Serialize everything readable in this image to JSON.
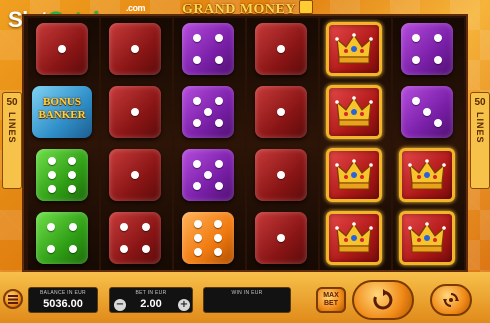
{
  "watermark": {
    "slot": "Slot",
    "catalog": "Catalog",
    "dotcom": ".com"
  },
  "game_title": "GRAND MONEY",
  "lines_indicator": {
    "count": "50",
    "word": "LINES"
  },
  "reels": [
    {
      "symbols": [
        "die-red-1",
        "bonus-banker",
        "die-green-6",
        "die-green-4"
      ]
    },
    {
      "symbols": [
        "die-red-1",
        "die-red-1",
        "die-red-1",
        "die-red-4"
      ]
    },
    {
      "symbols": [
        "die-purple-4",
        "die-purple-5",
        "die-purple-5",
        "die-orange-6"
      ]
    },
    {
      "symbols": [
        "die-red-1",
        "die-red-1",
        "die-red-1",
        "die-red-1"
      ]
    },
    {
      "symbols": [
        "crown",
        "crown",
        "crown",
        "crown"
      ]
    },
    {
      "symbols": [
        "die-purple-4",
        "die-purple-3",
        "crown",
        "crown"
      ]
    }
  ],
  "bonus_symbol_label": "BONUS BANKER",
  "balance": {
    "label": "BALANCE IN EUR",
    "value": "5036.00"
  },
  "bet": {
    "label": "BET IN EUR",
    "value": "2.00",
    "minus": "−",
    "plus": "+"
  },
  "win": {
    "label": "WIN IN EUR",
    "value": ""
  },
  "max_bet_label": "MAX BET",
  "colors": {
    "red": "#b02020",
    "purple": "#8a2cc0",
    "green": "#39b01c",
    "orange": "#f58a18",
    "gold": "#f4b428"
  },
  "icons": {
    "menu": "menu-icon",
    "spin": "spin-icon",
    "autoplay": "autoplay-icon"
  }
}
